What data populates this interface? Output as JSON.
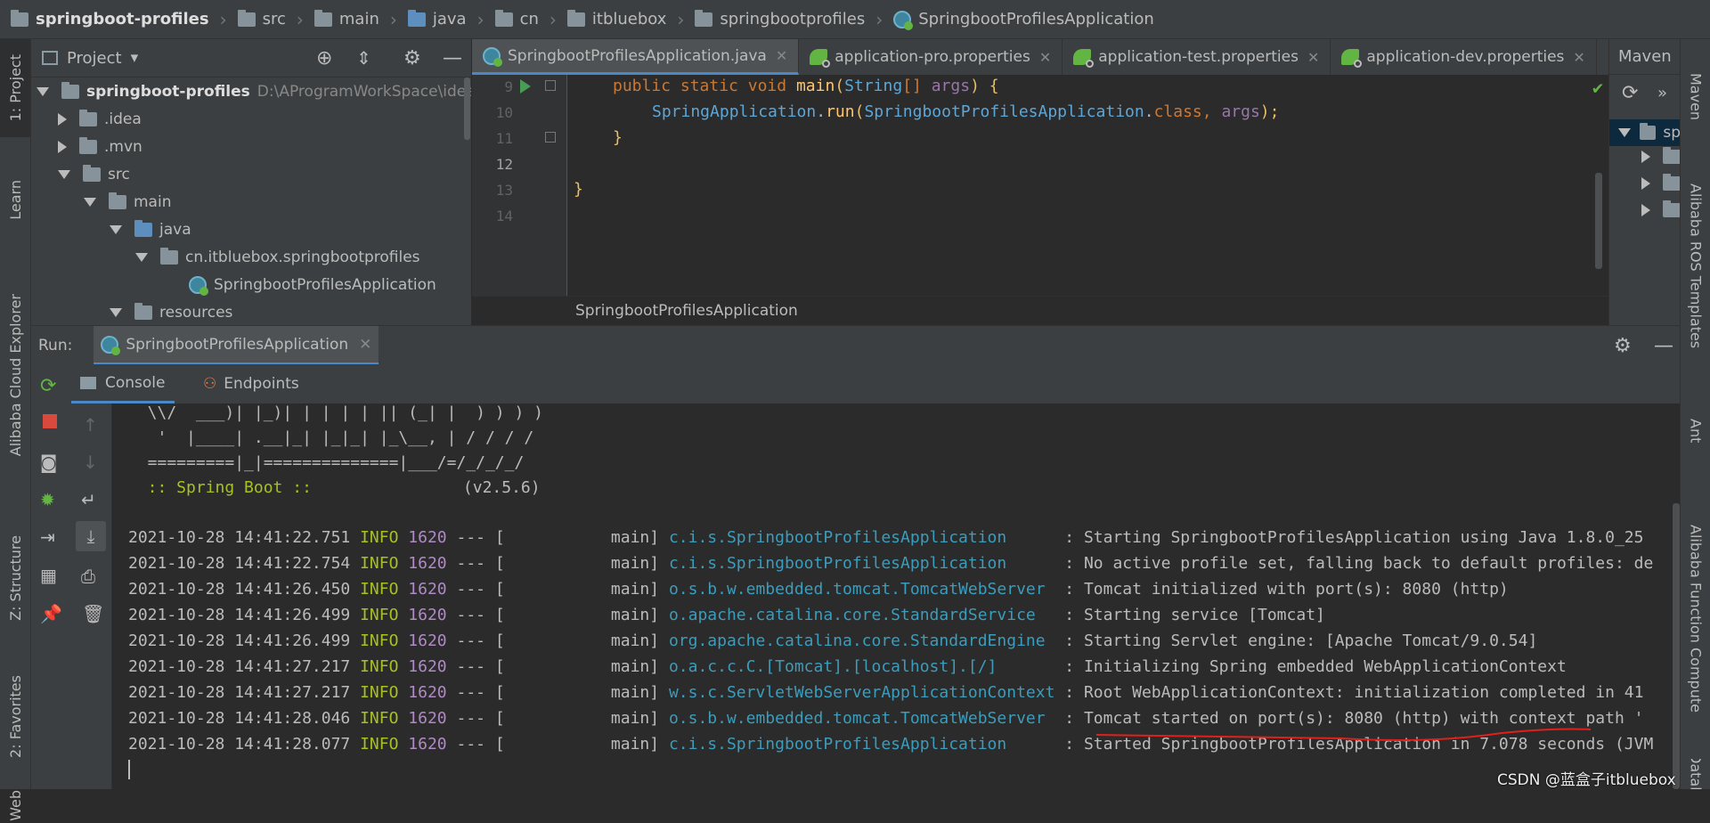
{
  "breadcrumb": [
    {
      "label": "springboot-profiles",
      "icon": "folder-icon"
    },
    {
      "label": "src",
      "icon": "folder-icon"
    },
    {
      "label": "main",
      "icon": "folder-icon"
    },
    {
      "label": "java",
      "icon": "folder-icon"
    },
    {
      "label": "cn",
      "icon": "package-icon"
    },
    {
      "label": "itbluebox",
      "icon": "package-icon"
    },
    {
      "label": "springbootprofiles",
      "icon": "package-icon"
    },
    {
      "label": "SpringbootProfilesApplication",
      "icon": "spring-class-icon"
    }
  ],
  "left_tabs": {
    "project": "1: Project",
    "learn": "Learn",
    "cloud": "Alibaba Cloud Explorer",
    "structure": "Z: Structure",
    "favorites": "2: Favorites",
    "web": "Web"
  },
  "right_tabs": {
    "maven": "Maven",
    "ros": "Alibaba ROS Templates",
    "ant": "Ant",
    "fc": "Alibaba Function Compute",
    "db": "Datab"
  },
  "project": {
    "title": "Project",
    "tree": [
      {
        "label": "springboot-profiles",
        "extra": "D:\\AProgramWorkSpace\\idea\\sp",
        "bold": true
      },
      {
        "label": ".idea"
      },
      {
        "label": ".mvn"
      },
      {
        "label": "src"
      },
      {
        "label": "main"
      },
      {
        "label": "java"
      },
      {
        "label": "cn.itbluebox.springbootprofiles"
      },
      {
        "label": "SpringbootProfilesApplication"
      },
      {
        "label": "resources"
      }
    ]
  },
  "editor": {
    "tabs": [
      {
        "label": "SpringbootProfilesApplication.java"
      },
      {
        "label": "application-pro.properties"
      },
      {
        "label": "application-test.properties"
      },
      {
        "label": "application-dev.properties"
      }
    ],
    "line_numbers": [
      "9",
      "10",
      "11",
      "12",
      "13",
      "14"
    ],
    "code": {
      "l9_kw1": "public",
      "l9_kw2": "static",
      "l9_kw3": "void",
      "l9_fn": "main",
      "l9_p1": "(",
      "l9_ty": "String",
      "l9_arr": "[]",
      "l9_arg": "args",
      "l9_p2": ") {",
      "l10_cls": "SpringApplication",
      "l10_dot": ".",
      "l10_fn": "run",
      "l10_p1": "(",
      "l10_cls2": "SpringbootProfilesApplication",
      "l10_dot2": ".",
      "l10_kw": "class",
      "l10_comma": ",",
      "l10_arg": "args",
      "l10_p2": ");",
      "l11": "}",
      "l13": "}"
    },
    "breadcrumb": "SpringbootProfilesApplication"
  },
  "maven": {
    "title": "Maven",
    "item": "sp"
  },
  "run": {
    "label": "Run:",
    "tab": "SpringbootProfilesApplication",
    "subtabs": {
      "console": "Console",
      "endpoints": "Endpoints"
    }
  },
  "console": {
    "banner": [
      "  \\\\/  ___)| |_)| | | | | || (_| |  ) ) ) )",
      "   '  |____| .__|_| |_|_| |_\\__, | / / / /",
      "  =========|_|==============|___/=/_/_/_/"
    ],
    "spring_boot": "  :: Spring Boot ::",
    "version": "(v2.5.6)",
    "logs": [
      {
        "ts": "2021-10-28 14:41:22.751",
        "lvl": "INFO",
        "pid": "1620",
        "sep": "--- [",
        "thread": "main]",
        "logger": "c.i.s.SpringbootProfilesApplication      ",
        "msg": ": Starting SpringbootProfilesApplication using Java 1.8.0_25"
      },
      {
        "ts": "2021-10-28 14:41:22.754",
        "lvl": "INFO",
        "pid": "1620",
        "sep": "--- [",
        "thread": "main]",
        "logger": "c.i.s.SpringbootProfilesApplication      ",
        "msg": ": No active profile set, falling back to default profiles: de"
      },
      {
        "ts": "2021-10-28 14:41:26.450",
        "lvl": "INFO",
        "pid": "1620",
        "sep": "--- [",
        "thread": "main]",
        "logger": "o.s.b.w.embedded.tomcat.TomcatWebServer  ",
        "msg": ": Tomcat initialized with port(s): 8080 (http)"
      },
      {
        "ts": "2021-10-28 14:41:26.499",
        "lvl": "INFO",
        "pid": "1620",
        "sep": "--- [",
        "thread": "main]",
        "logger": "o.apache.catalina.core.StandardService   ",
        "msg": ": Starting service [Tomcat]"
      },
      {
        "ts": "2021-10-28 14:41:26.499",
        "lvl": "INFO",
        "pid": "1620",
        "sep": "--- [",
        "thread": "main]",
        "logger": "org.apache.catalina.core.StandardEngine  ",
        "msg": ": Starting Servlet engine: [Apache Tomcat/9.0.54]"
      },
      {
        "ts": "2021-10-28 14:41:27.217",
        "lvl": "INFO",
        "pid": "1620",
        "sep": "--- [",
        "thread": "main]",
        "logger": "o.a.c.c.C.[Tomcat].[localhost].[/]       ",
        "msg": ": Initializing Spring embedded WebApplicationContext"
      },
      {
        "ts": "2021-10-28 14:41:27.217",
        "lvl": "INFO",
        "pid": "1620",
        "sep": "--- [",
        "thread": "main]",
        "logger": "w.s.c.ServletWebServerApplicationContext ",
        "msg": ": Root WebApplicationContext: initialization completed in 41"
      },
      {
        "ts": "2021-10-28 14:41:28.046",
        "lvl": "INFO",
        "pid": "1620",
        "sep": "--- [",
        "thread": "main]",
        "logger": "o.s.b.w.embedded.tomcat.TomcatWebServer  ",
        "msg": ": Tomcat started on port(s): 8080 (http) with context path '"
      },
      {
        "ts": "2021-10-28 14:41:28.077",
        "lvl": "INFO",
        "pid": "1620",
        "sep": "--- [",
        "thread": "main]",
        "logger": "c.i.s.SpringbootProfilesApplication      ",
        "msg": ": Started SpringbootProfilesApplication in 7.078 seconds (JVM"
      }
    ]
  },
  "watermark": "CSDN @蓝盒子itbluebox",
  "colors": {
    "annotation": "#e0201a",
    "accent": "#4a88c7"
  }
}
